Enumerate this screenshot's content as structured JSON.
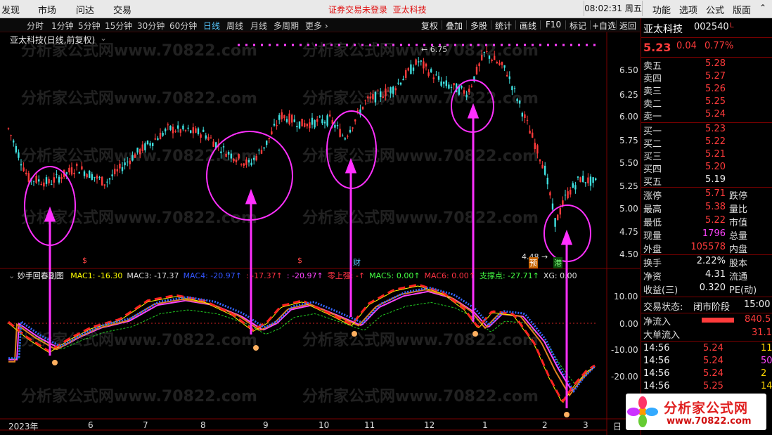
{
  "menu": {
    "items": [
      "发现",
      "市场",
      "问达",
      "交易"
    ],
    "login_status": "证券交易未登录",
    "stock_short": "亚太科技",
    "clock": "08:02:31 周五",
    "right_items": [
      "功能",
      "选项",
      "公式",
      "版面"
    ]
  },
  "periods": [
    "分时",
    "1分钟",
    "5分钟",
    "15分钟",
    "30分钟",
    "60分钟",
    "日线",
    "周线",
    "月线",
    "多周期",
    "更多"
  ],
  "tools": [
    "复权",
    "叠加",
    "多股",
    "统计",
    "画线",
    "F10",
    "标记",
    "+自选",
    "返回"
  ],
  "chart": {
    "title": "亚太科技(日线,前复权)",
    "price_ticks": [
      "6.50",
      "6.25",
      "6.00",
      "5.75",
      "5.50",
      "5.25",
      "5.00",
      "4.75",
      "4.50"
    ],
    "high_label": "6.75",
    "low_label": "4.48",
    "markers": {
      "yu": "预",
      "gang": "港",
      "cai": "财",
      "s1": "$",
      "s2": "$"
    },
    "indicator": {
      "name": "妙手回春副图",
      "items": [
        {
          "t": "MAC1: -16.30",
          "c": "#ffff00"
        },
        {
          "t": "MAC3: -17.37",
          "c": "#dddddd"
        },
        {
          "t": "MAC4: -20.97",
          "c": "#3355ff"
        },
        {
          "t": ": -17.37",
          "c": "#ff3344"
        },
        {
          "t": ": -20.97",
          "c": "#ff44ff"
        },
        {
          "t": "零上强: -",
          "c": "#ff3344"
        },
        {
          "t": "MAC5: 0.00",
          "c": "#44ff44"
        },
        {
          "t": "MAC6: 0.00",
          "c": "#ff3344"
        },
        {
          "t": "支撑点: -27.71",
          "c": "#44ff44"
        },
        {
          "t": "XG: 0.00",
          "c": "#dddddd"
        }
      ],
      "ticks": [
        "10.00",
        "0.00",
        "-10.00",
        "-20.00"
      ]
    },
    "x_labels": [
      "2023年",
      "6",
      "7",
      "8",
      "9",
      "10",
      "11",
      "12",
      "1",
      "2",
      "3"
    ],
    "x_corner": "日"
  },
  "quote": {
    "name": "亚太科技",
    "code": "002540",
    "flag": "L",
    "price": "5.23",
    "change": "0.04",
    "pct": "0.77%",
    "asks": [
      {
        "n": "卖五",
        "p": "5.28"
      },
      {
        "n": "卖四",
        "p": "5.27"
      },
      {
        "n": "卖三",
        "p": "5.26"
      },
      {
        "n": "卖二",
        "p": "5.25"
      },
      {
        "n": "卖一",
        "p": "5.24"
      }
    ],
    "bids": [
      {
        "n": "买一",
        "p": "5.23"
      },
      {
        "n": "买二",
        "p": "5.22"
      },
      {
        "n": "买三",
        "p": "5.21"
      },
      {
        "n": "买四",
        "p": "5.20"
      },
      {
        "n": "买五",
        "p": "5.19"
      }
    ],
    "stats": [
      {
        "n": "涨停",
        "v": "5.71",
        "n2": "跌停",
        "c": "red"
      },
      {
        "n": "最高",
        "v": "5.38",
        "n2": "量比",
        "c": "red"
      },
      {
        "n": "最低",
        "v": "5.22",
        "n2": "市值",
        "c": "red"
      },
      {
        "n": "现量",
        "v": "1796",
        "n2": "总量",
        "c": "mag"
      },
      {
        "n": "外盘",
        "v": "105578",
        "n2": "内盘",
        "c": "red"
      }
    ],
    "stats2": [
      {
        "n": "换手",
        "v": "2.22%",
        "n2": "股本"
      },
      {
        "n": "净资",
        "v": "4.31",
        "n2": "流通"
      },
      {
        "n": "收益(三)",
        "v": "0.320",
        "n2": "PE(动)"
      }
    ],
    "trade_status_label": "交易状态:",
    "trade_status": "闭市阶段",
    "trade_time": "15:00",
    "net_inflow_label": "净流入",
    "net_inflow": "840.5",
    "big_inflow_label": "大单流入",
    "big_inflow": "31.1",
    "ticks": [
      {
        "t": "14:56",
        "p": "5.24",
        "v": "11",
        "vc": "yel"
      },
      {
        "t": "14:56",
        "p": "5.24",
        "v": "50",
        "vc": "mag"
      },
      {
        "t": "14:56",
        "p": "5.24",
        "v": "2",
        "vc": "yel"
      },
      {
        "t": "14:56",
        "p": "5.25",
        "v": "14",
        "vc": "yel"
      }
    ]
  },
  "logo": {
    "text": "分析家公式网",
    "url": "www.70822.com"
  },
  "watermark": "分析家公式网www.70822.com"
}
